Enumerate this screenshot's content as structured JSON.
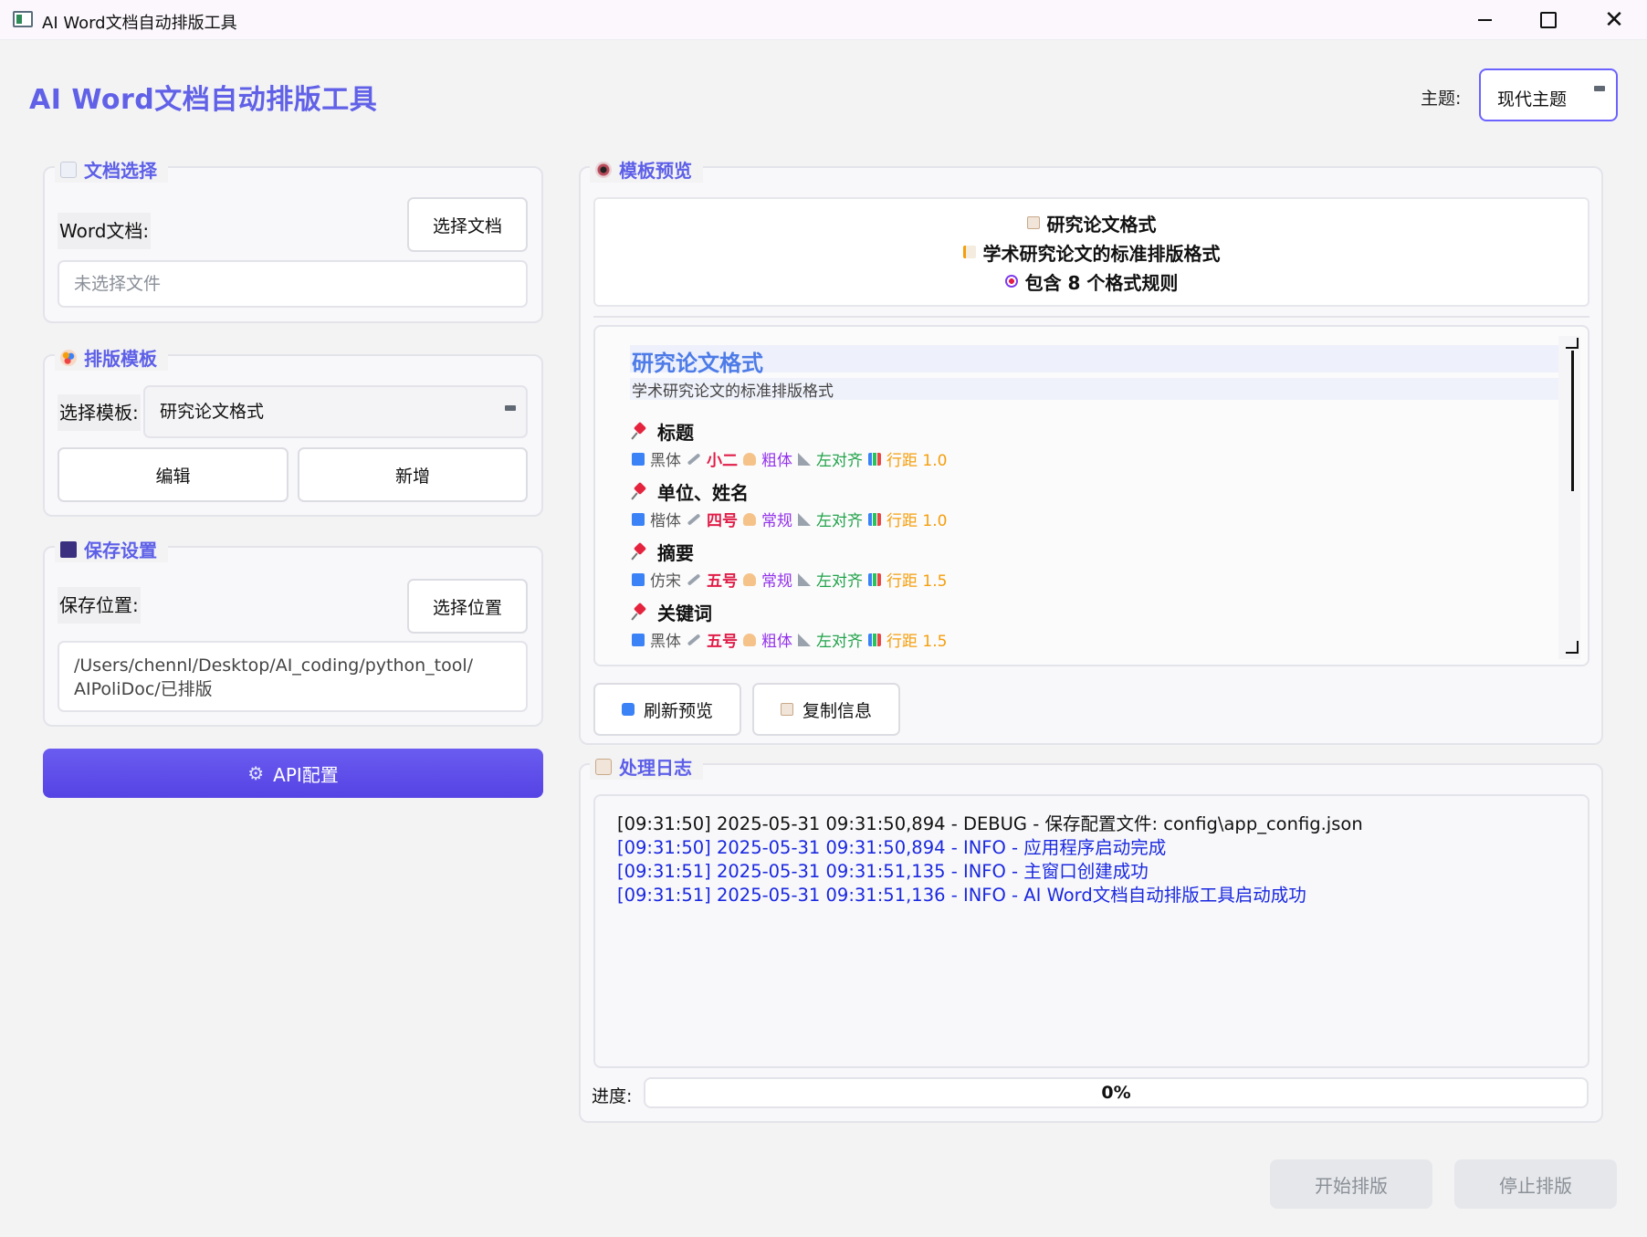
{
  "window": {
    "title": "AI Word文档自动排版工具",
    "controls": [
      "minimize",
      "maximize",
      "close"
    ]
  },
  "header": {
    "title": "AI Word文档自动排版工具",
    "theme_label": "主题:",
    "theme_value": "现代主题"
  },
  "doc_group": {
    "title": "文档选择",
    "icon": "document-icon",
    "word_label": "Word文档:",
    "select_button": "选择文档",
    "file_placeholder": "未选择文件"
  },
  "template_group": {
    "title": "排版模板",
    "icon": "palette-icon",
    "select_label": "选择模板:",
    "selected_template": "研究论文格式",
    "edit_button": "编辑",
    "add_button": "新增"
  },
  "save_group": {
    "title": "保存设置",
    "icon": "floppy-disk-icon",
    "location_label": "保存位置:",
    "select_button": "选择位置",
    "path_line1": "/Users/chennl/Desktop/AI_coding/python_tool/",
    "path_line2": "AIPoliDoc/已排版"
  },
  "api_button": {
    "label": "API配置",
    "icon": "gear-icon"
  },
  "preview_group": {
    "title": "模板预览",
    "icon": "eye-icon",
    "summary": {
      "name": "研究论文格式",
      "description": "学术研究论文的标准排版格式",
      "rule_count_text": "包含 8 个格式规则"
    },
    "body": {
      "title": "研究论文格式",
      "subtitle": "学术研究论文的标准排版格式",
      "rules": [
        {
          "name": "标题",
          "font": "黑体",
          "size": "小二",
          "weight": "粗体",
          "align": "左对齐",
          "spacing": "行距 1.0"
        },
        {
          "name": "单位、姓名",
          "font": "楷体",
          "size": "四号",
          "weight": "常规",
          "align": "左对齐",
          "spacing": "行距 1.0"
        },
        {
          "name": "摘要",
          "font": "仿宋",
          "size": "五号",
          "weight": "常规",
          "align": "左对齐",
          "spacing": "行距 1.5"
        },
        {
          "name": "关键词",
          "font": "黑体",
          "size": "五号",
          "weight": "粗体",
          "align": "左对齐",
          "spacing": "行距 1.5"
        }
      ]
    },
    "refresh_button": "刷新预览",
    "copy_button": "复制信息"
  },
  "log_group": {
    "title": "处理日志",
    "icon": "clipboard-icon",
    "lines": [
      {
        "level": "debug",
        "text": "[09:31:50] 2025-05-31 09:31:50,894 - DEBUG - 保存配置文件: config\\app_config.json"
      },
      {
        "level": "info",
        "text": "[09:31:50] 2025-05-31 09:31:50,894 - INFO - 应用程序启动完成"
      },
      {
        "level": "info",
        "text": "[09:31:51] 2025-05-31 09:31:51,135 - INFO - 主窗口创建成功"
      },
      {
        "level": "info",
        "text": "[09:31:51] 2025-05-31 09:31:51,136 - INFO - AI Word文档自动排版工具启动成功"
      }
    ],
    "progress_label": "进度:",
    "progress_value": 0,
    "progress_text": "0%"
  },
  "actions": {
    "start_button": "开始排版",
    "stop_button": "停止排版"
  },
  "colors": {
    "accent": "#6161e8",
    "info_log": "#1a28e0",
    "pin": "#e5233d"
  }
}
